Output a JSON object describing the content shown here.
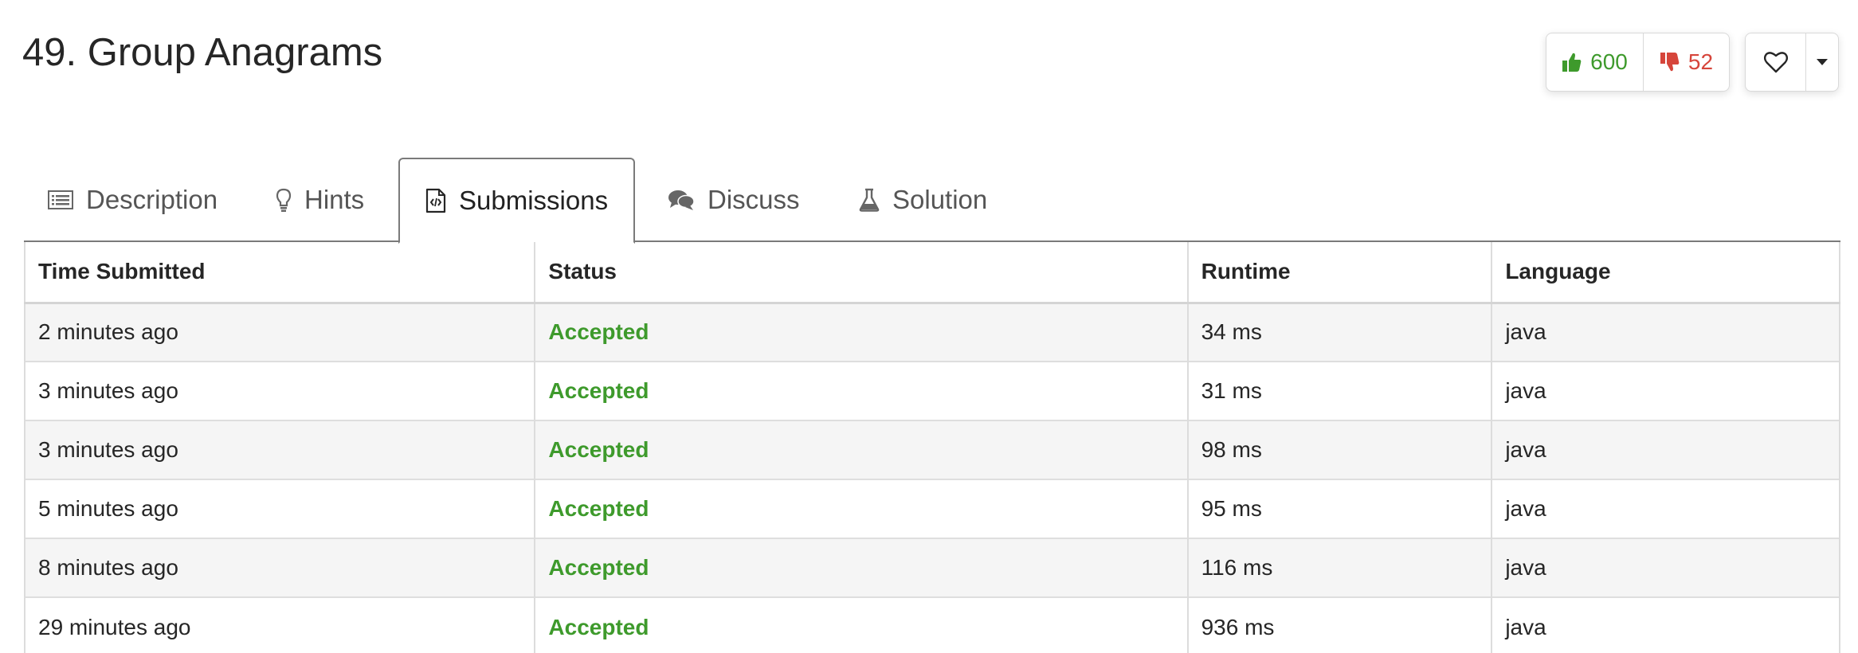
{
  "problem": {
    "title": "49. Group Anagrams",
    "likes": "600",
    "dislikes": "52"
  },
  "colors": {
    "accepted": "#3e9a2c",
    "like": "#3e9a2c",
    "dislike": "#d6453b"
  },
  "tabs": [
    {
      "label": "Description",
      "icon": "list-icon"
    },
    {
      "label": "Hints",
      "icon": "lightbulb-icon"
    },
    {
      "label": "Submissions",
      "icon": "code-file-icon",
      "active": true
    },
    {
      "label": "Discuss",
      "icon": "comments-icon"
    },
    {
      "label": "Solution",
      "icon": "flask-icon"
    }
  ],
  "table": {
    "headers": [
      "Time Submitted",
      "Status",
      "Runtime",
      "Language"
    ],
    "rows": [
      {
        "time": "2 minutes ago",
        "status": "Accepted",
        "runtime": "34 ms",
        "language": "java"
      },
      {
        "time": "3 minutes ago",
        "status": "Accepted",
        "runtime": "31 ms",
        "language": "java"
      },
      {
        "time": "3 minutes ago",
        "status": "Accepted",
        "runtime": "98 ms",
        "language": "java"
      },
      {
        "time": "5 minutes ago",
        "status": "Accepted",
        "runtime": "95 ms",
        "language": "java"
      },
      {
        "time": "8 minutes ago",
        "status": "Accepted",
        "runtime": "116 ms",
        "language": "java"
      },
      {
        "time": "29 minutes ago",
        "status": "Accepted",
        "runtime": "936 ms",
        "language": "java"
      }
    ]
  }
}
